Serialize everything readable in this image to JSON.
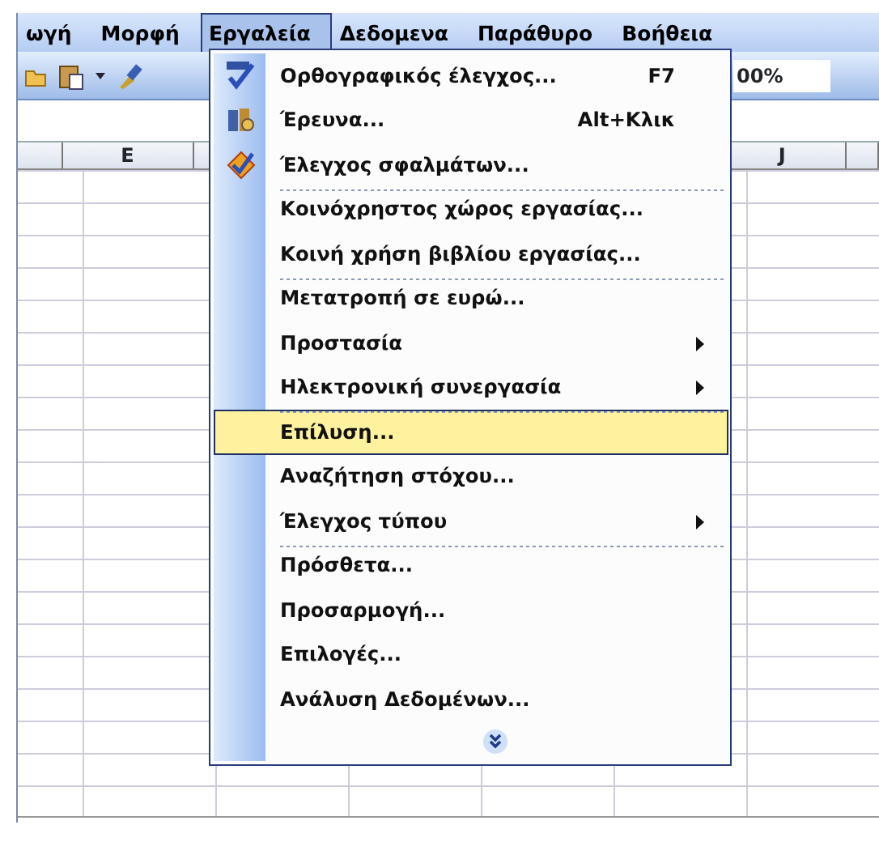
{
  "menu_bar": [
    {
      "label": "ωγή",
      "selected": false
    },
    {
      "label": "Μορφή",
      "selected": false
    },
    {
      "label": "Εργαλεία",
      "selected": true
    },
    {
      "label": "Δεδομενα",
      "selected": false
    },
    {
      "label": "Παράθυρο",
      "selected": false
    },
    {
      "label": "Βοήθεια",
      "selected": false
    }
  ],
  "toolbar": {
    "zoom": "00%"
  },
  "column_headers": [
    "E",
    "J"
  ],
  "tools_menu": [
    {
      "label": "Ορθογραφικός έλεγχος...",
      "shortcut": "F7",
      "submenu": false,
      "separator_before": false,
      "selected": false
    },
    {
      "label": "Έρευνα...",
      "shortcut": "Alt+Κλικ",
      "submenu": false,
      "separator_before": false,
      "selected": false
    },
    {
      "label": "Έλεγχος σφαλμάτων...",
      "submenu": false,
      "separator_before": false,
      "selected": false
    },
    {
      "label": "Κοινόχρηστος χώρος εργασίας...",
      "submenu": false,
      "separator_before": true,
      "selected": false
    },
    {
      "label": "Κοινή χρήση βιβλίου εργασίας...",
      "submenu": false,
      "separator_before": false,
      "selected": false
    },
    {
      "label": "Μετατροπή σε ευρώ...",
      "submenu": false,
      "separator_before": true,
      "selected": false
    },
    {
      "label": "Προστασία",
      "submenu": true,
      "separator_before": false,
      "selected": false
    },
    {
      "label": "Ηλεκτρονική συνεργασία",
      "submenu": true,
      "separator_before": false,
      "selected": false
    },
    {
      "label": "Επίλυση...",
      "submenu": false,
      "separator_before": true,
      "selected": true
    },
    {
      "label": "Αναζήτηση στόχου...",
      "submenu": false,
      "separator_before": false,
      "selected": false
    },
    {
      "label": "Έλεγχος τύπου",
      "submenu": true,
      "separator_before": false,
      "selected": false
    },
    {
      "label": "Πρόσθετα...",
      "submenu": false,
      "separator_before": true,
      "selected": false
    },
    {
      "label": "Προσαρμογή...",
      "submenu": false,
      "separator_before": false,
      "selected": false
    },
    {
      "label": "Επιλογές...",
      "submenu": false,
      "separator_before": false,
      "selected": false
    },
    {
      "label": "Ανάλυση Δεδομένων...",
      "submenu": false,
      "separator_before": false,
      "selected": false
    }
  ]
}
